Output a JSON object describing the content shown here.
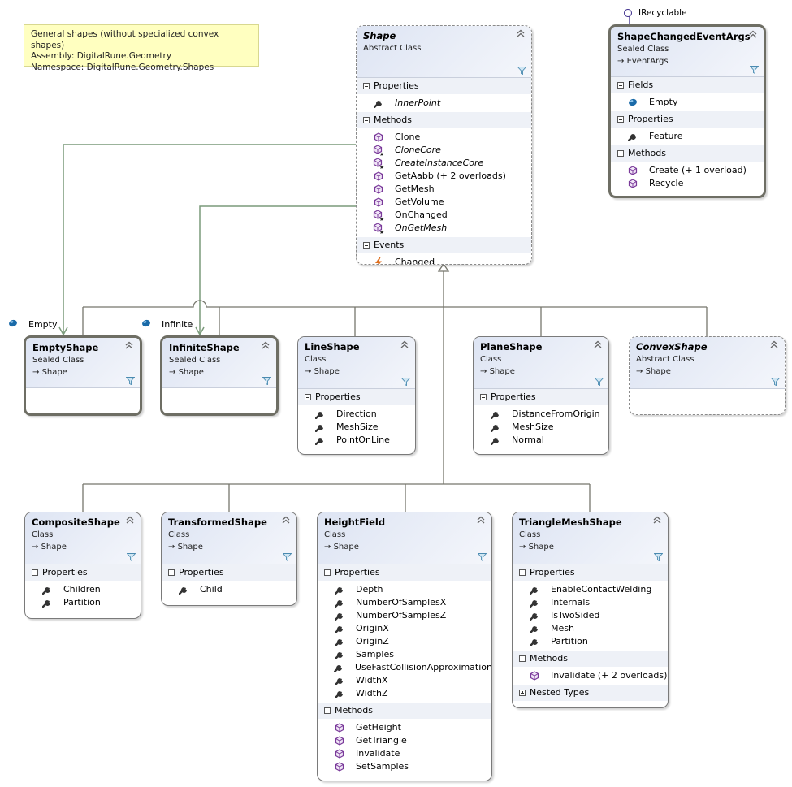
{
  "note": {
    "lines": [
      "General shapes (without specialized convex shapes)",
      "Assembly: DigitalRune.Geometry",
      "Namespace: DigitalRune.Geometry.Shapes"
    ]
  },
  "colors": {
    "association": "#7a9a7a",
    "inheritance": "#6e6e64",
    "header_gradient_start": "#dde4f3",
    "note_bg": "#ffffc0",
    "method_icon": "#7a3a9a",
    "field_icon": "#1a6aa8",
    "event_icon": "#e07020"
  },
  "interface_lollipop": {
    "label": "IRecyclable"
  },
  "field_labels": {
    "empty": {
      "icon": "field-icon",
      "label": "Empty"
    },
    "infinite": {
      "icon": "field-icon",
      "label": "Infinite"
    }
  },
  "classes": {
    "shape": {
      "name": "Shape",
      "kind": "Abstract Class",
      "sections": [
        {
          "title": "Properties",
          "members": [
            {
              "icon": "property-icon",
              "name": "InnerPoint",
              "italic": true
            }
          ]
        },
        {
          "title": "Methods",
          "members": [
            {
              "icon": "method-icon",
              "name": "Clone"
            },
            {
              "icon": "protected-method-icon",
              "name": "CloneCore",
              "italic": true
            },
            {
              "icon": "protected-method-icon",
              "name": "CreateInstanceCore",
              "italic": true
            },
            {
              "icon": "method-icon",
              "name": "GetAabb (+ 2 overloads)"
            },
            {
              "icon": "method-icon",
              "name": "GetMesh"
            },
            {
              "icon": "method-icon",
              "name": "GetVolume"
            },
            {
              "icon": "protected-method-icon",
              "name": "OnChanged"
            },
            {
              "icon": "protected-method-icon",
              "name": "OnGetMesh",
              "italic": true
            }
          ]
        },
        {
          "title": "Events",
          "members": [
            {
              "icon": "event-icon",
              "name": "Changed"
            }
          ]
        }
      ]
    },
    "shapeChangedEventArgs": {
      "name": "ShapeChangedEventArgs",
      "kind": "Sealed Class",
      "base": "EventArgs",
      "sections": [
        {
          "title": "Fields",
          "members": [
            {
              "icon": "field-icon",
              "name": "Empty"
            }
          ]
        },
        {
          "title": "Properties",
          "members": [
            {
              "icon": "property-icon",
              "name": "Feature"
            }
          ]
        },
        {
          "title": "Methods",
          "members": [
            {
              "icon": "method-icon",
              "name": "Create (+ 1 overload)"
            },
            {
              "icon": "method-icon",
              "name": "Recycle"
            }
          ]
        }
      ]
    },
    "emptyShape": {
      "name": "EmptyShape",
      "kind": "Sealed Class",
      "base": "Shape",
      "sections": []
    },
    "infiniteShape": {
      "name": "InfiniteShape",
      "kind": "Sealed Class",
      "base": "Shape",
      "sections": []
    },
    "lineShape": {
      "name": "LineShape",
      "kind": "Class",
      "base": "Shape",
      "sections": [
        {
          "title": "Properties",
          "members": [
            {
              "icon": "property-icon",
              "name": "Direction"
            },
            {
              "icon": "property-icon",
              "name": "MeshSize"
            },
            {
              "icon": "property-icon",
              "name": "PointOnLine"
            }
          ]
        }
      ]
    },
    "planeShape": {
      "name": "PlaneShape",
      "kind": "Class",
      "base": "Shape",
      "sections": [
        {
          "title": "Properties",
          "members": [
            {
              "icon": "property-icon",
              "name": "DistanceFromOrigin"
            },
            {
              "icon": "property-icon",
              "name": "MeshSize"
            },
            {
              "icon": "property-icon",
              "name": "Normal"
            }
          ]
        }
      ]
    },
    "convexShape": {
      "name": "ConvexShape",
      "kind": "Abstract Class",
      "base": "Shape",
      "sections": []
    },
    "compositeShape": {
      "name": "CompositeShape",
      "kind": "Class",
      "base": "Shape",
      "sections": [
        {
          "title": "Properties",
          "members": [
            {
              "icon": "property-icon",
              "name": "Children"
            },
            {
              "icon": "property-icon",
              "name": "Partition"
            }
          ]
        }
      ]
    },
    "transformedShape": {
      "name": "TransformedShape",
      "kind": "Class",
      "base": "Shape",
      "sections": [
        {
          "title": "Properties",
          "members": [
            {
              "icon": "property-icon",
              "name": "Child"
            }
          ]
        }
      ]
    },
    "heightField": {
      "name": "HeightField",
      "kind": "Class",
      "base": "Shape",
      "sections": [
        {
          "title": "Properties",
          "members": [
            {
              "icon": "property-icon",
              "name": "Depth"
            },
            {
              "icon": "property-icon",
              "name": "NumberOfSamplesX"
            },
            {
              "icon": "property-icon",
              "name": "NumberOfSamplesZ"
            },
            {
              "icon": "property-icon",
              "name": "OriginX"
            },
            {
              "icon": "property-icon",
              "name": "OriginZ"
            },
            {
              "icon": "property-icon",
              "name": "Samples"
            },
            {
              "icon": "property-icon",
              "name": "UseFastCollisionApproximation"
            },
            {
              "icon": "property-icon",
              "name": "WidthX"
            },
            {
              "icon": "property-icon",
              "name": "WidthZ"
            }
          ]
        },
        {
          "title": "Methods",
          "members": [
            {
              "icon": "method-icon",
              "name": "GetHeight"
            },
            {
              "icon": "method-icon",
              "name": "GetTriangle"
            },
            {
              "icon": "method-icon",
              "name": "Invalidate"
            },
            {
              "icon": "method-icon",
              "name": "SetSamples"
            }
          ]
        }
      ]
    },
    "triangleMeshShape": {
      "name": "TriangleMeshShape",
      "kind": "Class",
      "base": "Shape",
      "sections": [
        {
          "title": "Properties",
          "members": [
            {
              "icon": "property-icon",
              "name": "EnableContactWelding"
            },
            {
              "icon": "property-icon",
              "name": "Internals"
            },
            {
              "icon": "property-icon",
              "name": "IsTwoSided"
            },
            {
              "icon": "property-icon",
              "name": "Mesh"
            },
            {
              "icon": "property-icon",
              "name": "Partition"
            }
          ]
        },
        {
          "title": "Methods",
          "members": [
            {
              "icon": "method-icon",
              "name": "Invalidate (+ 2 overloads)"
            }
          ]
        },
        {
          "title": "Nested Types",
          "collapsed": true,
          "members": []
        }
      ]
    }
  }
}
